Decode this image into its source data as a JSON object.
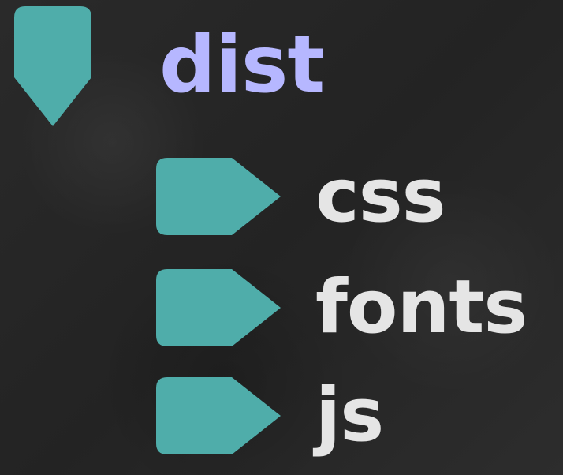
{
  "tree": {
    "root": {
      "label": "dist",
      "expanded": true,
      "icon": "chevron-down-icon"
    },
    "children": [
      {
        "label": "css",
        "expanded": false,
        "icon": "chevron-right-icon"
      },
      {
        "label": "fonts",
        "expanded": false,
        "icon": "chevron-right-icon"
      },
      {
        "label": "js",
        "expanded": false,
        "icon": "chevron-right-icon"
      }
    ]
  },
  "colors": {
    "chevron": "#4fadaa",
    "root_text": "#b6b7ff",
    "child_text": "#e5e5e5",
    "background": "#2b2b2b"
  }
}
